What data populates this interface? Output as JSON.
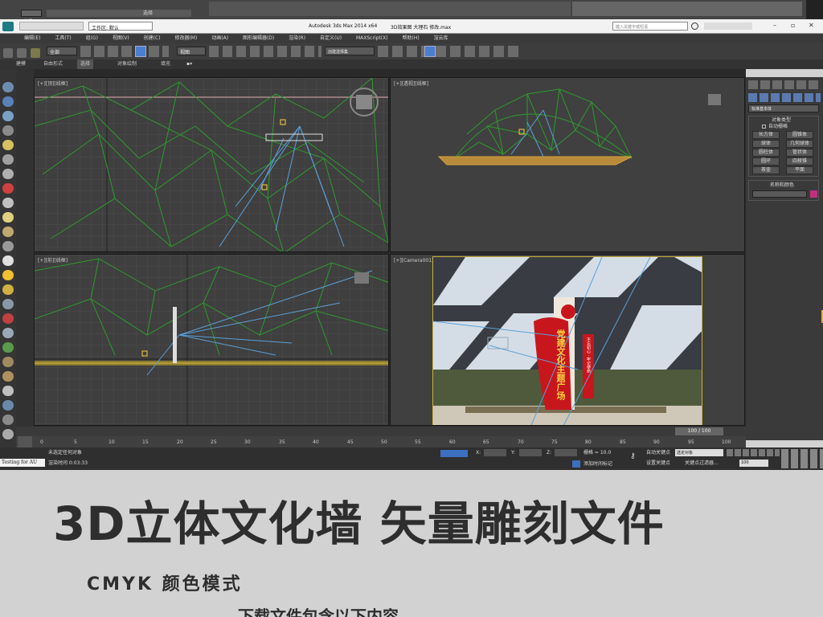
{
  "topstrip": {
    "selection_label": "选择",
    "name_field": "选择"
  },
  "titlebar": {
    "workspace": "工作区: 默认",
    "app_title": "Autodesk 3ds Max  2014 x64",
    "file_title": "3D效果图 大理石 修改.max",
    "search_placeholder": "键入关键字或短语"
  },
  "menu": [
    "编辑(E)",
    "工具(T)",
    "组(G)",
    "视图(V)",
    "创建(C)",
    "修改器(M)",
    "动画(A)",
    "图形编辑器(D)",
    "渲染(R)",
    "自定义(U)",
    "MAXScript(X)",
    "帮助(H)",
    "渲云库"
  ],
  "toolbar": {
    "filter_value": "全部",
    "coord_value": "视图",
    "selection_set": "创建选择集"
  },
  "ribbon_tabs": [
    "建模",
    "自由形式",
    "选择",
    "对象绘制",
    "填充"
  ],
  "viewports": {
    "top_left": "[+][顶][线框]",
    "top_right": "[+][透视][线框]",
    "bottom_left": "[+][前][线框]",
    "bottom_right": "[+][Camera001][真实]"
  },
  "sign": {
    "main_text": "党建文化主题广场",
    "sub_text": "不忘初心 · 牢记使命"
  },
  "command_panel": {
    "dropdown": "标准基本体",
    "rollout_object_type": "对象类型",
    "auto_grid": "自动栅格",
    "buttons": [
      "长方体",
      "圆锥体",
      "球体",
      "几何球体",
      "圆柱体",
      "管状体",
      "圆环",
      "四棱锥",
      "茶壶",
      "平面"
    ],
    "rollout_name_color": "名称和颜色"
  },
  "timeline": {
    "frame_counter": "100 / 100",
    "ticks": [
      "0",
      "5",
      "10",
      "15",
      "20",
      "25",
      "30",
      "35",
      "40",
      "45",
      "50",
      "55",
      "60",
      "65",
      "70",
      "75",
      "80",
      "85",
      "90",
      "95",
      "100"
    ]
  },
  "status": {
    "script_label": "Testing for AU",
    "selection_status": "未选定任何对象",
    "render_time": "渲染时间  0:03:33",
    "x_label": "X:",
    "y_label": "Y:",
    "z_label": "Z:",
    "grid_label": "栅格 = 10.0",
    "auto_key": "自动关键点",
    "set_key": "设置关键点",
    "key_mode": "选定对象",
    "key_filters": "关键点过滤器...",
    "add_time_tag": "添加时间标记",
    "frame_field": "100"
  },
  "banner": {
    "headline": "3D立体文化墙  矢量雕刻文件",
    "subline": "CMYK 颜色模式",
    "partial_text": "下载文件包含以下内容"
  },
  "colors": {
    "ui_dark": "#3b3b3b",
    "viewport_bg": "#3f3f3f",
    "wire_green": "#33a033",
    "wire_blue": "#5aa0d8",
    "sign_red": "#c8161d",
    "camera_border": "#c9b13a",
    "banner_bg": "#d2d2d2",
    "headline": "#2e2e2e"
  }
}
